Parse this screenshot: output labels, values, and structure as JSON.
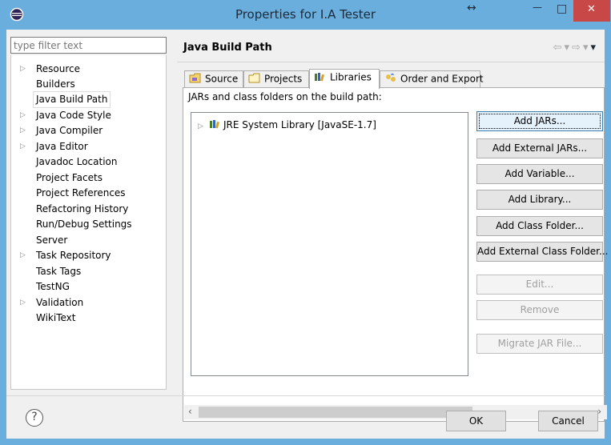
{
  "window": {
    "title": "Properties for I.A Tester",
    "resize_glyph": "↔",
    "min_glyph": "—",
    "max_glyph": "□",
    "close_glyph": "✕"
  },
  "filter": {
    "placeholder": "type filter text"
  },
  "tree": {
    "items": [
      {
        "label": "Resource",
        "expandable": true
      },
      {
        "label": "Builders",
        "expandable": false
      },
      {
        "label": "Java Build Path",
        "expandable": false,
        "selected": true
      },
      {
        "label": "Java Code Style",
        "expandable": true
      },
      {
        "label": "Java Compiler",
        "expandable": true
      },
      {
        "label": "Java Editor",
        "expandable": true
      },
      {
        "label": "Javadoc Location",
        "expandable": false
      },
      {
        "label": "Project Facets",
        "expandable": false
      },
      {
        "label": "Project References",
        "expandable": false
      },
      {
        "label": "Refactoring History",
        "expandable": false
      },
      {
        "label": "Run/Debug Settings",
        "expandable": false
      },
      {
        "label": "Server",
        "expandable": false
      },
      {
        "label": "Task Repository",
        "expandable": true
      },
      {
        "label": "Task Tags",
        "expandable": false
      },
      {
        "label": "TestNG",
        "expandable": false
      },
      {
        "label": "Validation",
        "expandable": true
      },
      {
        "label": "WikiText",
        "expandable": false
      }
    ]
  },
  "page": {
    "title": "Java Build Path",
    "tabs": [
      {
        "label": "Source",
        "icon": "source-folder-icon"
      },
      {
        "label": "Projects",
        "icon": "projects-folder-icon"
      },
      {
        "label": "Libraries",
        "icon": "libraries-icon",
        "active": true
      },
      {
        "label": "Order and Export",
        "icon": "order-export-icon"
      }
    ],
    "libraries_label": "JARs and class folders on the build path:",
    "entries": [
      {
        "label": "JRE System Library [JavaSE-1.7]",
        "icon": "library-icon"
      }
    ],
    "buttons": {
      "add_jars": "Add JARs...",
      "add_external_jars": "Add External JARs...",
      "add_variable": "Add Variable...",
      "add_library": "Add Library...",
      "add_class_folder": "Add Class Folder...",
      "add_external_class_folder": "Add External Class Folder...",
      "edit": "Edit...",
      "remove": "Remove",
      "migrate_jar": "Migrate JAR File..."
    }
  },
  "footer": {
    "help_glyph": "?",
    "ok": "OK",
    "cancel": "Cancel"
  },
  "colors": {
    "title_bar": "#6aaede",
    "close_button": "#c74846",
    "dialog_bg": "#f0f0f0"
  }
}
